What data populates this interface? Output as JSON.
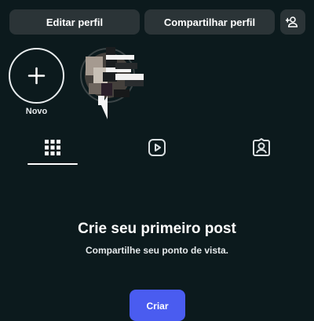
{
  "colors": {
    "background": "#0c1a1d",
    "button_bg": "#2b3437",
    "accent": "#4a5cf0",
    "text": "#ffffff"
  },
  "header": {
    "edit_profile_label": "Editar perfil",
    "share_profile_label": "Compartilhar perfil",
    "add_user_icon": "add-person-icon"
  },
  "highlights": {
    "new_label": "Novo",
    "new_icon": "plus-icon"
  },
  "tabs": [
    {
      "icon": "grid-icon",
      "selected": true
    },
    {
      "icon": "reels-icon",
      "selected": false
    },
    {
      "icon": "tagged-icon",
      "selected": false
    }
  ],
  "empty_state": {
    "title": "Crie seu primeiro post",
    "subtitle": "Compartilhe seu ponto de vista.",
    "create_label": "Criar"
  }
}
